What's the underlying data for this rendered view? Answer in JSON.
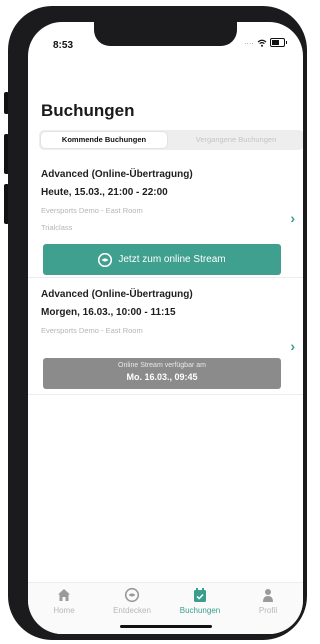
{
  "status_bar": {
    "time": "8:53",
    "signal_dots": "....",
    "icons": [
      "wifi-icon",
      "battery-icon"
    ]
  },
  "header": {
    "title": "Buchungen"
  },
  "segments": {
    "upcoming_label": "Kommende Buchungen",
    "past_label": "Vergangene Buchungen",
    "selected": "Kommende Buchungen"
  },
  "bookings": [
    {
      "title": "Advanced (Online-Übertragung)",
      "datetime": "Heute, 15.03., 21:00 - 22:00",
      "location": "Eversports Demo - East Room",
      "type": "Trialclass",
      "action_label": "Jetzt zum online Stream",
      "action_icon": "eversports-logo-icon"
    },
    {
      "title": "Advanced (Online-Übertragung)",
      "datetime": "Morgen, 16.03., 10:00 - 11:15",
      "location": "Eversports Demo - East Room",
      "availability_label": "Online Stream verfügbar am",
      "availability_date": "Mo. 16.03., 09:45"
    }
  ],
  "chevron": "›",
  "tabbar": {
    "items": [
      {
        "label": "Home",
        "icon": "home-icon"
      },
      {
        "label": "Entdecken",
        "icon": "discover-icon"
      },
      {
        "label": "Buchungen",
        "icon": "calendar-check-icon"
      },
      {
        "label": "Profil",
        "icon": "person-icon"
      }
    ],
    "active": "Buchungen"
  },
  "colors": {
    "accent": "#3fa08f",
    "disabled": "#8b8b8b",
    "inactive_text": "#b8b8b8"
  }
}
